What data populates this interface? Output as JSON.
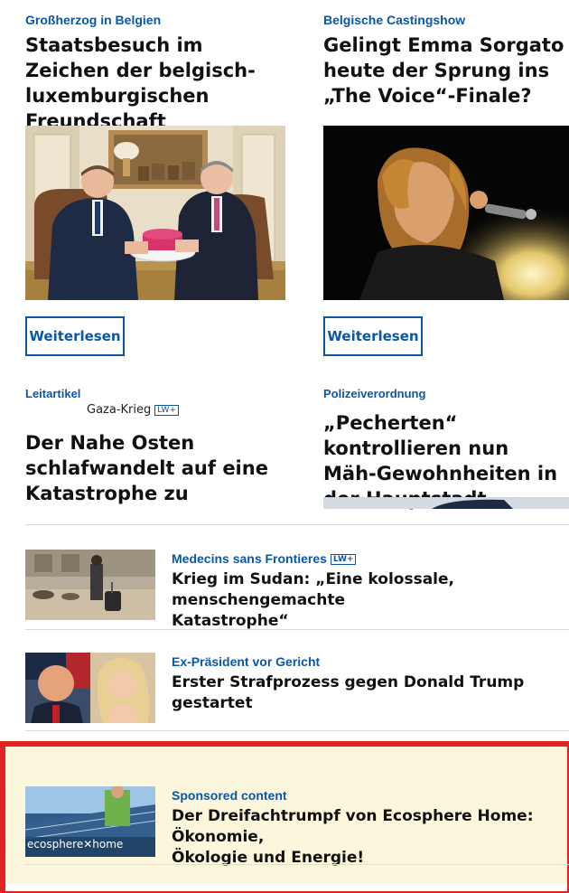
{
  "cards": [
    {
      "kicker": "Großherzog in Belgien",
      "headline": "Staatsbesuch im Zeichen der belgisch-luxemburgischen Freundschaft",
      "button": "Weiterlesen",
      "image_icon": "photo-royal-meeting"
    },
    {
      "kicker": "Belgische Castingshow",
      "headline": "Gelingt Emma Sorgato heute der Sprung ins „The Voice“-Finale?",
      "button": "Weiterlesen",
      "image_icon": "photo-singer-stage"
    },
    {
      "kicker": "Leitartikel",
      "subkicker": "Gaza-Krieg",
      "badge": "LW+",
      "headline": "Der Nahe Osten schlafwandelt auf eine Katastrophe zu"
    },
    {
      "kicker": "Polizeiverordnung",
      "headline": "„Pecherten“ kontrollieren nun Mäh-Gewohnheiten in der Hauptstadt"
    }
  ],
  "rows": [
    {
      "kicker": "Medecins sans Frontieres",
      "badge": "LW+",
      "title": "Krieg im Sudan: „Eine kolossale, menschengemachte\nKatastrophe“",
      "image_icon": "photo-refugees"
    },
    {
      "kicker": "Ex-Präsident vor Gericht",
      "title": "Erster Strafprozess gegen Donald Trump gestartet",
      "image_icon": "photo-trump-daniels"
    }
  ],
  "sponsored": {
    "kicker": "Sponsored content",
    "title": "Der Dreifachtrumpf von Ecosphere Home: Ökonomie,\nÖkologie und Energie!",
    "logo_text": "ecosphere",
    "logo_text_2": "home",
    "highlight_color": "#e02424"
  },
  "colors": {
    "accent": "#0b57a4",
    "sponsored_bg": "#fbf6dc"
  }
}
